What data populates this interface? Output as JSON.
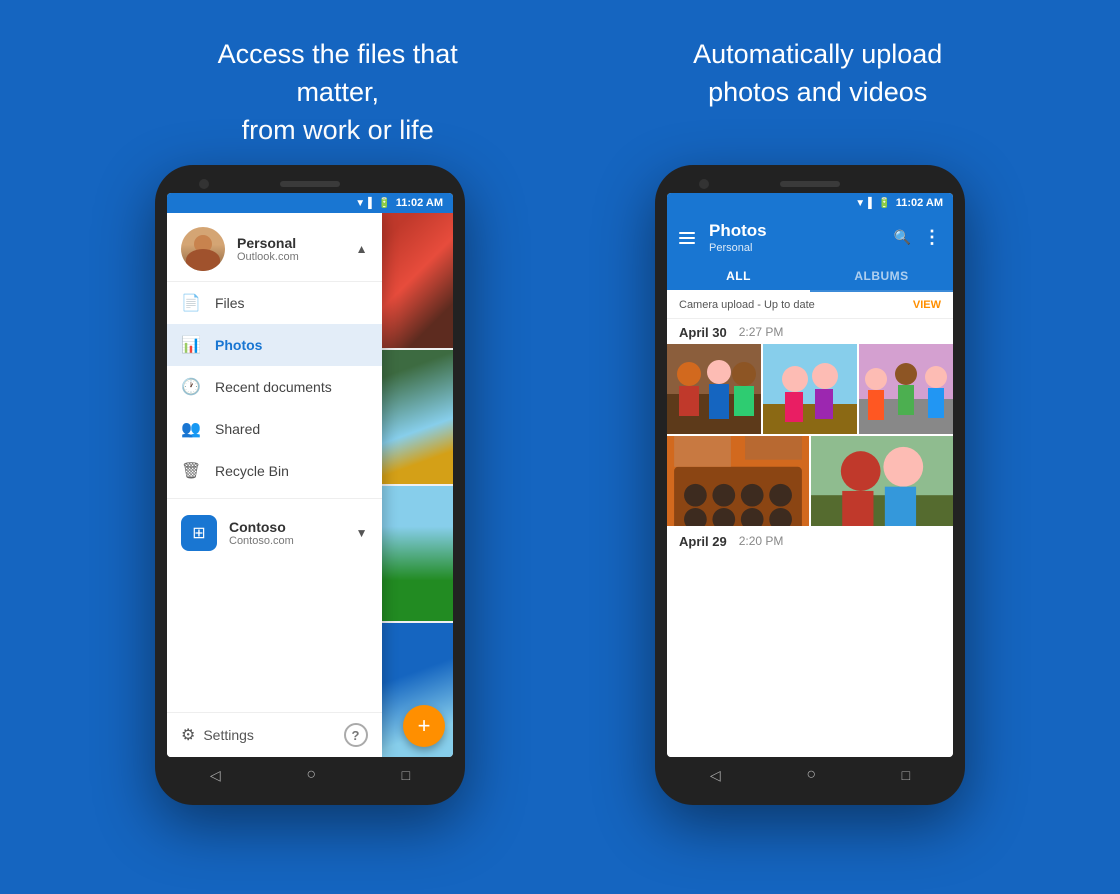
{
  "background_color": "#1565C0",
  "left_headline": {
    "line1": "Access the files that matter,",
    "line2": "from work or life"
  },
  "right_headline": {
    "line1": "Automatically upload",
    "line2": "photos and videos"
  },
  "phone1": {
    "status_bar": {
      "time": "11:02 AM"
    },
    "drawer": {
      "account": {
        "name": "Personal",
        "email": "Outlook.com"
      },
      "items": [
        {
          "icon": "📄",
          "label": "Files",
          "active": false
        },
        {
          "icon": "📊",
          "label": "Photos",
          "active": true
        },
        {
          "icon": "🕐",
          "label": "Recent documents",
          "active": false
        },
        {
          "icon": "👥",
          "label": "Shared",
          "active": false
        },
        {
          "icon": "🗑",
          "label": "Recycle Bin",
          "active": false
        }
      ],
      "second_account": {
        "name": "Contoso",
        "domain": "Contoso.com"
      },
      "footer": {
        "settings_label": "Settings",
        "help_label": "?"
      }
    },
    "nav": {
      "back": "◁",
      "home": "○",
      "recent": "□"
    }
  },
  "phone2": {
    "status_bar": {
      "time": "11:02 AM"
    },
    "toolbar": {
      "title": "Photos",
      "subtitle": "Personal",
      "search_icon": "search",
      "more_icon": "more"
    },
    "tabs": [
      {
        "label": "ALL",
        "active": true
      },
      {
        "label": "ALBUMS",
        "active": false
      }
    ],
    "camera_upload": {
      "text": "Camera upload - Up to date",
      "action": "VIEW"
    },
    "sections": [
      {
        "date": "April 30",
        "time": "2:27 PM",
        "photos": [
          "people_group",
          "people_street",
          "people_outdoor"
        ]
      },
      {
        "date": "",
        "time": "",
        "photos": [
          "food_baking",
          "couple_outdoor"
        ]
      }
    ],
    "second_date": {
      "date": "April 29",
      "time": "2:20 PM"
    },
    "nav": {
      "back": "◁",
      "home": "○",
      "recent": "□"
    }
  }
}
